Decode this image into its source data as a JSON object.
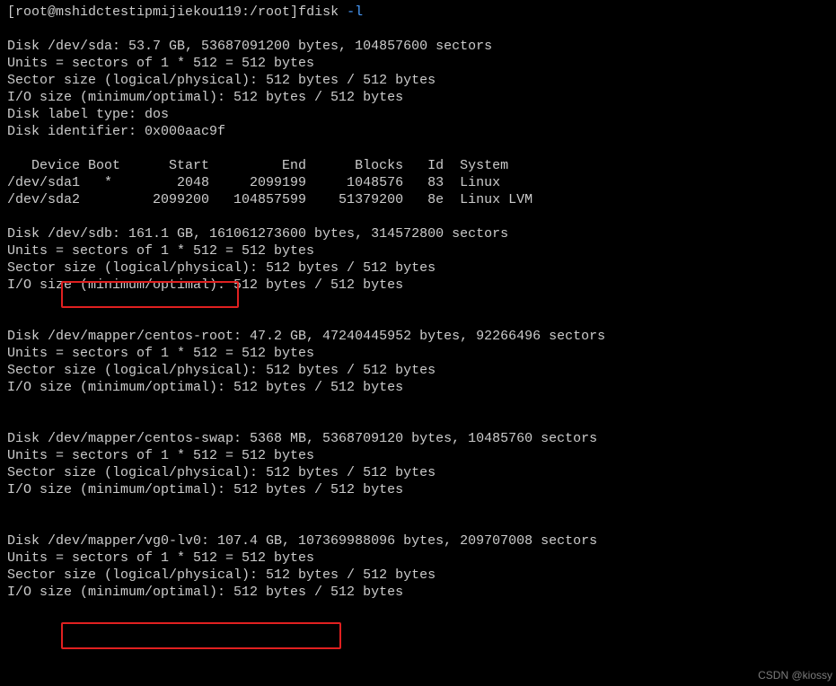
{
  "prompt": "[root@mshidctestipmijiekou119:/root]",
  "command": "fdisk",
  "flag": "-l",
  "disk_sda": {
    "header": "Disk /dev/sda: 53.7 GB, 53687091200 bytes, 104857600 sectors",
    "units": "Units = sectors of 1 * 512 = 512 bytes",
    "sector": "Sector size (logical/physical): 512 bytes / 512 bytes",
    "io": "I/O size (minimum/optimal): 512 bytes / 512 bytes",
    "label": "Disk label type: dos",
    "ident": "Disk identifier: 0x000aac9f"
  },
  "ptable_header": "   Device Boot      Start         End      Blocks   Id  System",
  "ptable_r1": "/dev/sda1   *        2048     2099199     1048576   83  Linux",
  "ptable_r2": "/dev/sda2         2099200   104857599    51379200   8e  Linux LVM",
  "disk_sdb": {
    "header": "Disk /dev/sdb: 161.1 GB, 161061273600 bytes, 314572800 sectors",
    "units": "Units = sectors of 1 * 512 = 512 bytes",
    "sector": "Sector size (logical/physical): 512 bytes / 512 bytes",
    "io": "I/O size (minimum/optimal): 512 bytes / 512 bytes"
  },
  "disk_root": {
    "header": "Disk /dev/mapper/centos-root: 47.2 GB, 47240445952 bytes, 92266496 sectors",
    "units": "Units = sectors of 1 * 512 = 512 bytes",
    "sector": "Sector size (logical/physical): 512 bytes / 512 bytes",
    "io": "I/O size (minimum/optimal): 512 bytes / 512 bytes"
  },
  "disk_swap": {
    "header": "Disk /dev/mapper/centos-swap: 5368 MB, 5368709120 bytes, 10485760 sectors",
    "units": "Units = sectors of 1 * 512 = 512 bytes",
    "sector": "Sector size (logical/physical): 512 bytes / 512 bytes",
    "io": "I/O size (minimum/optimal): 512 bytes / 512 bytes"
  },
  "disk_vg0": {
    "header": "Disk /dev/mapper/vg0-lv0: 107.4 GB, 107369988096 bytes, 209707008 sectors",
    "units": "Units = sectors of 1 * 512 = 512 bytes",
    "sector": "Sector size (logical/physical): 512 bytes / 512 bytes",
    "io": "I/O size (minimum/optimal): 512 bytes / 512 bytes"
  },
  "watermark": "CSDN @kiossy"
}
